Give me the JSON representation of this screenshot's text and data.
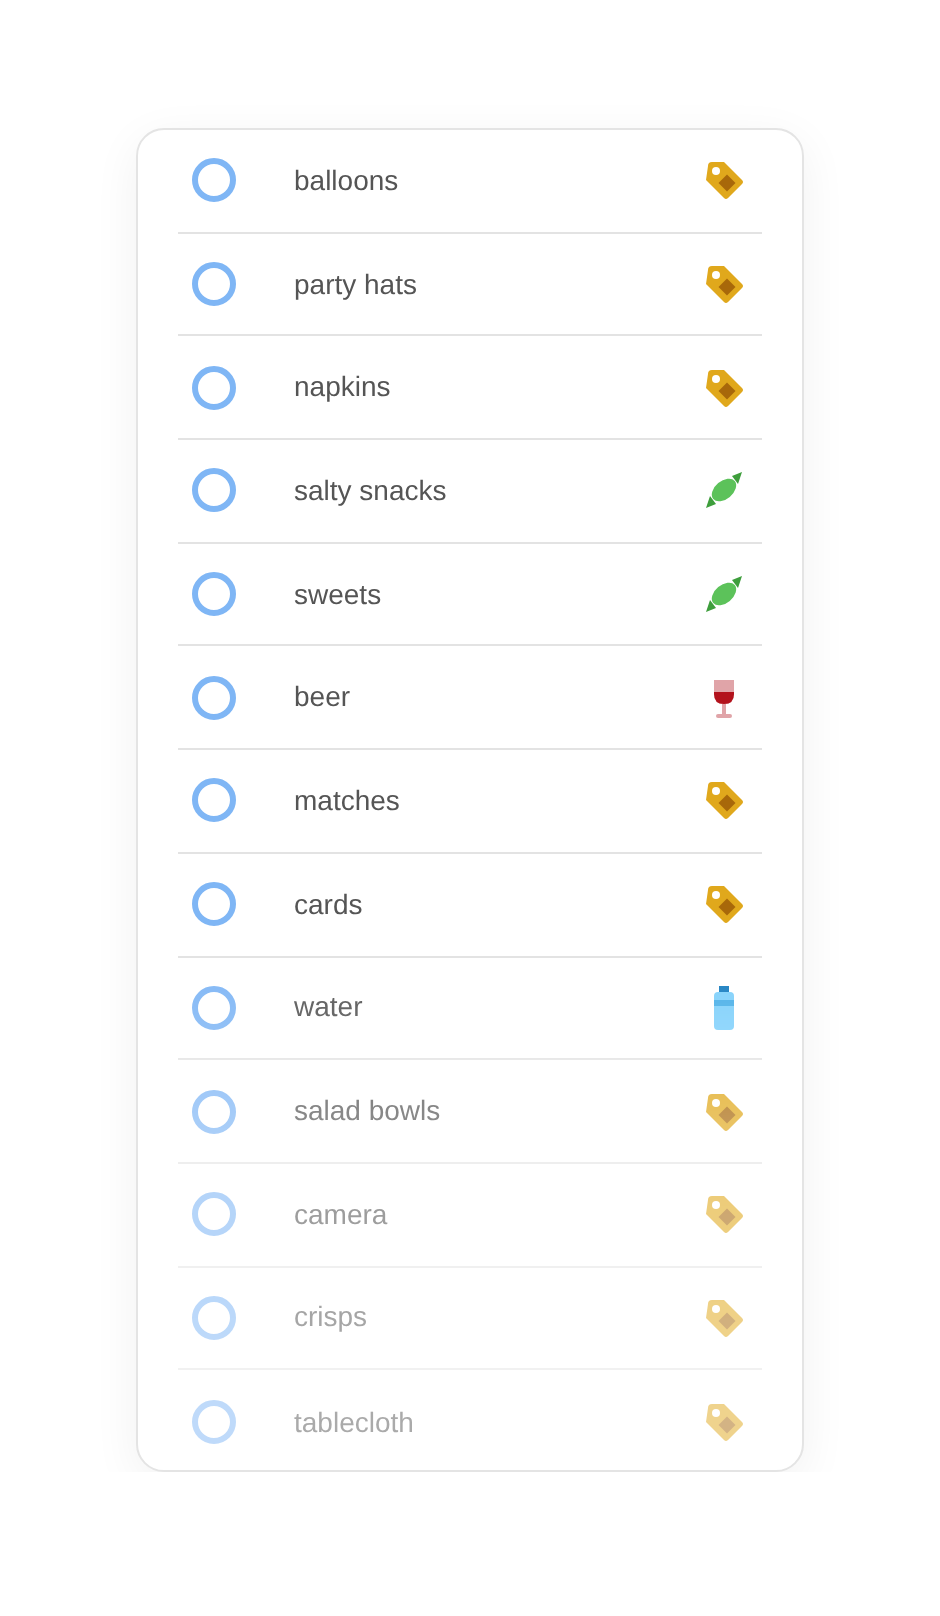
{
  "items": [
    {
      "label": "balloons",
      "checked": false,
      "kind": "tag"
    },
    {
      "label": "party hats",
      "checked": false,
      "kind": "tag"
    },
    {
      "label": "napkins",
      "checked": false,
      "kind": "tag"
    },
    {
      "label": "salty snacks",
      "checked": false,
      "kind": "candy"
    },
    {
      "label": "sweets",
      "checked": false,
      "kind": "candy"
    },
    {
      "label": "beer",
      "checked": false,
      "kind": "wine"
    },
    {
      "label": "matches",
      "checked": false,
      "kind": "tag"
    },
    {
      "label": "cards",
      "checked": false,
      "kind": "tag"
    },
    {
      "label": "water",
      "checked": false,
      "kind": "bottle"
    },
    {
      "label": "salad bowls",
      "checked": false,
      "kind": "tag"
    },
    {
      "label": "camera",
      "checked": false,
      "kind": "tag"
    },
    {
      "label": "crisps",
      "checked": false,
      "kind": "tag"
    },
    {
      "label": "tablecloth",
      "checked": false,
      "kind": "tag"
    }
  ]
}
